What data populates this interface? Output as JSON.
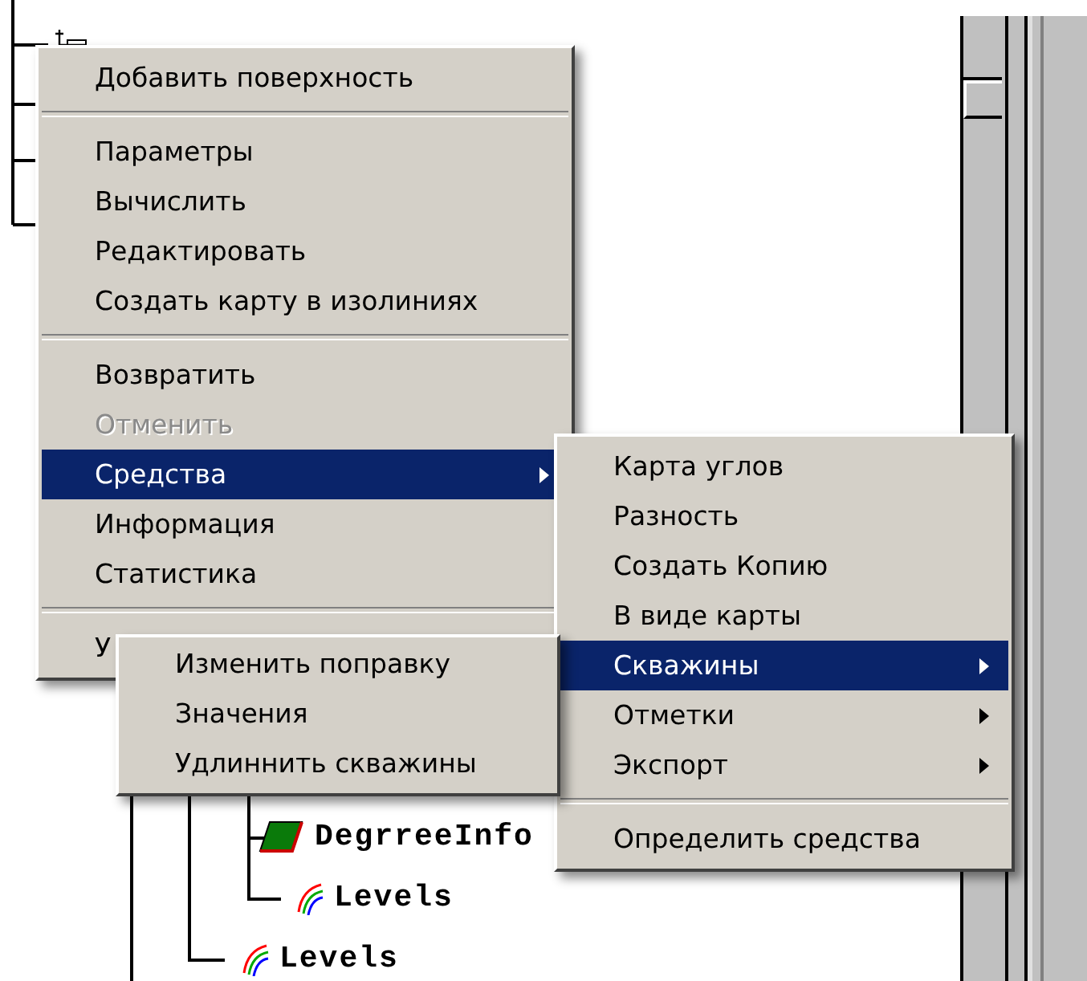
{
  "tree": [
    {
      "kind": "template",
      "children": [
        {
          "children": [
            {
              "children": [
                {
                  "label": "DegrreeInfo",
                  "kind": "grid"
                },
                {
                  "label": "Levels",
                  "kind": "levels"
                }
              ]
            },
            {
              "label": "Levels",
              "kind": "levels"
            }
          ]
        }
      ]
    }
  ],
  "context_menu": {
    "items": [
      {
        "kind": "item",
        "label": "Добавить поверхность",
        "disabled": false,
        "selected": false,
        "submenu": false
      },
      {
        "kind": "separator"
      },
      {
        "kind": "item",
        "label": "Параметры",
        "disabled": false,
        "selected": false,
        "submenu": false
      },
      {
        "kind": "item",
        "label": "Вычислить",
        "disabled": false,
        "selected": false,
        "submenu": false
      },
      {
        "kind": "item",
        "label": "Редактировать",
        "disabled": false,
        "selected": false,
        "submenu": false
      },
      {
        "kind": "item",
        "label": "Создать карту в изолиниях",
        "disabled": false,
        "selected": false,
        "submenu": false
      },
      {
        "kind": "separator"
      },
      {
        "kind": "item",
        "label": "Возвратить",
        "disabled": false,
        "selected": false,
        "submenu": false
      },
      {
        "kind": "item",
        "label": "Отменить",
        "disabled": true,
        "selected": false,
        "submenu": false
      },
      {
        "kind": "item",
        "label": "Средства",
        "disabled": false,
        "selected": true,
        "submenu": true
      },
      {
        "kind": "item",
        "label": "Информация",
        "disabled": false,
        "selected": false,
        "submenu": false
      },
      {
        "kind": "item",
        "label": "Статистика",
        "disabled": false,
        "selected": false,
        "submenu": false
      },
      {
        "kind": "separator"
      },
      {
        "kind": "item",
        "label": "У",
        "disabled": false,
        "selected": false,
        "submenu": false
      }
    ]
  },
  "tools_submenu": {
    "items": [
      {
        "kind": "item",
        "label": "Карта углов",
        "disabled": false,
        "selected": false,
        "submenu": false
      },
      {
        "kind": "item",
        "label": "Разность",
        "disabled": false,
        "selected": false,
        "submenu": false
      },
      {
        "kind": "item",
        "label": "Создать Копию",
        "disabled": false,
        "selected": false,
        "submenu": false
      },
      {
        "kind": "item",
        "label": "В виде карты",
        "disabled": false,
        "selected": false,
        "submenu": false
      },
      {
        "kind": "item",
        "label": "Скважины",
        "disabled": false,
        "selected": true,
        "submenu": true
      },
      {
        "kind": "item",
        "label": "Отметки",
        "disabled": false,
        "selected": false,
        "submenu": true
      },
      {
        "kind": "item",
        "label": "Экспорт",
        "disabled": false,
        "selected": false,
        "submenu": true
      },
      {
        "kind": "separator"
      },
      {
        "kind": "item",
        "label": "Определить средства",
        "disabled": false,
        "selected": false,
        "submenu": false
      }
    ]
  },
  "wells_submenu": {
    "items": [
      {
        "kind": "item",
        "label": "Изменить поправку",
        "disabled": false,
        "selected": false,
        "submenu": false
      },
      {
        "kind": "item",
        "label": "Значения",
        "disabled": false,
        "selected": false,
        "submenu": false
      },
      {
        "kind": "item",
        "label": "Удлиннить скважины",
        "disabled": false,
        "selected": false,
        "submenu": false
      }
    ]
  }
}
